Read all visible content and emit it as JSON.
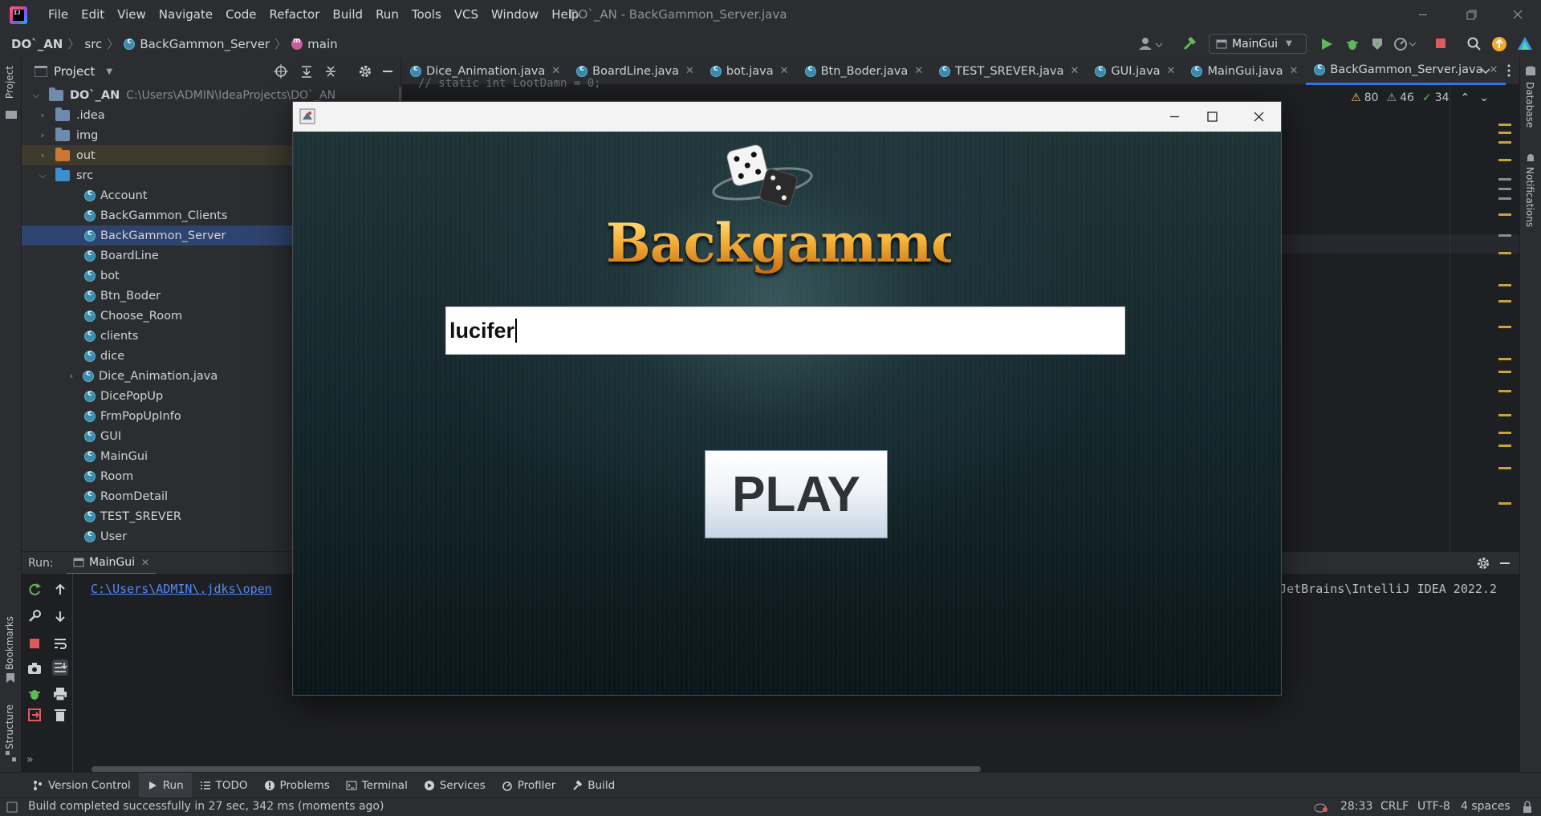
{
  "window_title": "DO`_AN - BackGammon_Server.java",
  "menu": [
    "File",
    "Edit",
    "View",
    "Navigate",
    "Code",
    "Refactor",
    "Build",
    "Run",
    "Tools",
    "VCS",
    "Window",
    "Help"
  ],
  "breadcrumb": {
    "project": "DO`_AN",
    "src": "src",
    "file": "BackGammon_Server",
    "method": "main"
  },
  "run_config": "MainGui",
  "project_panel": {
    "title": "Project",
    "root": {
      "name": "DO`_AN",
      "path": "C:\\Users\\ADMIN\\IdeaProjects\\DO`_AN"
    },
    "folders": [
      ".idea",
      "img",
      "out",
      "src"
    ],
    "classes": [
      "Account",
      "BackGammon_Clients",
      "BackGammon_Server",
      "BoardLine",
      "bot",
      "Btn_Boder",
      "Choose_Room",
      "clients",
      "dice",
      "Dice_Animation.java",
      "DicePopUp",
      "FrmPopUpInfo",
      "GUI",
      "MainGui",
      "Room",
      "RoomDetail",
      "TEST_SREVER",
      "User"
    ],
    "selected": "BackGammon_Server"
  },
  "editor_tabs": [
    "Dice_Animation.java",
    "BoardLine.java",
    "bot.java",
    "Btn_Boder.java",
    "TEST_SREVER.java",
    "GUI.java",
    "MainGui.java",
    "BackGammon_Server.java"
  ],
  "active_tab": "BackGammon_Server.java",
  "inspections": {
    "warnings": "80",
    "weak_warnings": "46",
    "typos": "34"
  },
  "editor_peek_text": "//    static int LootDamn = 0;",
  "left_strip": {
    "project": "Project",
    "bookmarks": "Bookmarks",
    "structure": "Structure"
  },
  "right_strip": {
    "database": "Database",
    "notifications": "Notifications"
  },
  "run_panel": {
    "label": "Run:",
    "tab": "MainGui",
    "console_left": "C:\\Users\\ADMIN\\.jdks\\open",
    "console_right": "JetBrains\\IntelliJ IDEA 2022.2"
  },
  "tool_tabs": [
    "Version Control",
    "Run",
    "TODO",
    "Problems",
    "Terminal",
    "Services",
    "Profiler",
    "Build"
  ],
  "status": {
    "message": "Build completed successfully in 27 sec, 342 ms (moments ago)",
    "position": "28:33",
    "line_sep": "CRLF",
    "encoding": "UTF-8",
    "indent": "4 spaces"
  },
  "game": {
    "logo": "Backgammon",
    "name_value": "lucifer",
    "play_label": "PLAY"
  },
  "colors": {
    "accent": "#3574f0",
    "selection": "#2e436e",
    "play_text": "#2f3237",
    "logo_gold": "#f4b444"
  }
}
